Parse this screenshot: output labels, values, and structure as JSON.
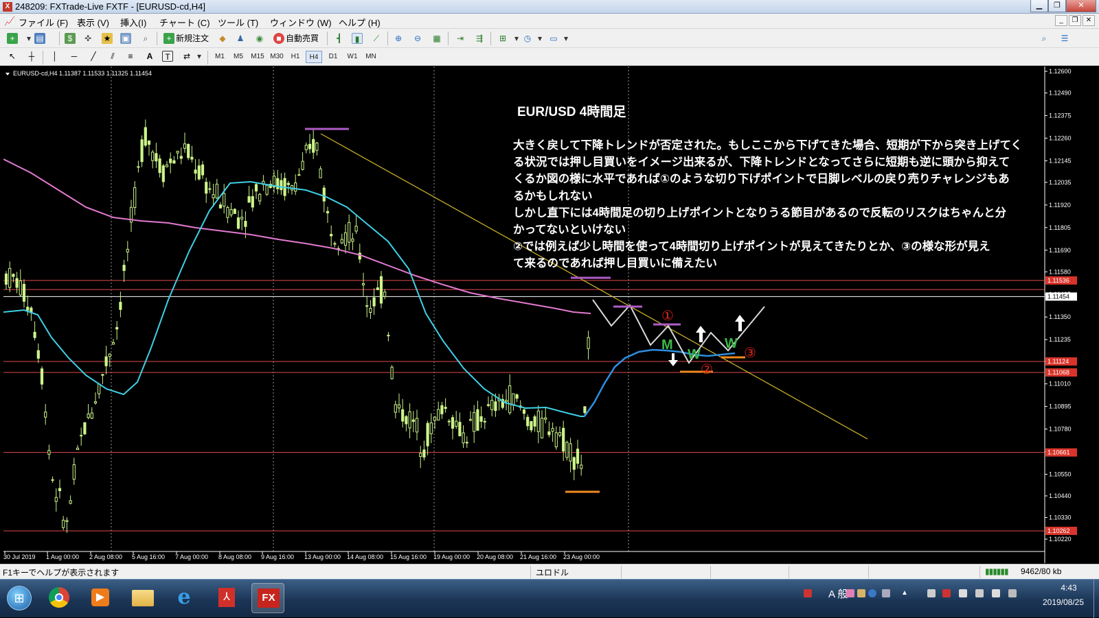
{
  "window": {
    "title": "248209: FXTrade-Live FXTF - [EURUSD-cd,H4]",
    "app_icon": "X"
  },
  "menu": [
    "ファイル (F)",
    "表示 (V)",
    "挿入(I)",
    "チャート (C)",
    "ツール (T)",
    "ウィンドウ (W)",
    "ヘルプ (H)"
  ],
  "toolbar": {
    "new_order": "新規注文",
    "auto_trade": "自動売買"
  },
  "toolbar2": {
    "text_tool": "A",
    "label_tool": "T"
  },
  "timeframes": [
    "M1",
    "M5",
    "M15",
    "M30",
    "H1",
    "H4",
    "D1",
    "W1",
    "MN"
  ],
  "active_timeframe": "H4",
  "chart": {
    "info": "EURUSD-cd,H4  1.11387 1.11533 1.11325 1.11454",
    "background": "#000000",
    "candle_color": "#ccf58a",
    "price_labels": [
      "1.12600",
      "1.12490",
      "1.12375",
      "1.12260",
      "1.12145",
      "1.12035",
      "1.11920",
      "1.11805",
      "1.11690",
      "1.11580",
      "1.11465",
      "1.11350",
      "1.11235",
      "1.11124",
      "1.11010",
      "1.10895",
      "1.10780",
      "1.10665",
      "1.10550",
      "1.10440",
      "1.10330",
      "1.10220"
    ],
    "time_labels": [
      "30 Jul 2019",
      "1 Aug 00:00",
      "2 Aug 08:00",
      "5 Aug 16:00",
      "7 Aug 00:00",
      "8 Aug 08:00",
      "9 Aug 16:00",
      "13 Aug 00:00",
      "14 Aug 08:00",
      "15 Aug 16:00",
      "19 Aug 00:00",
      "20 Aug 08:00",
      "21 Aug 16:00",
      "23 Aug 00:00"
    ],
    "hlines": [
      {
        "label": "1.11536",
        "color": "#e04a4a"
      },
      {
        "label": "1.11454",
        "color": "#ffffff"
      },
      {
        "label": "1.11124",
        "color": "#e04a4a"
      },
      {
        "label": "1.11068",
        "color": "#e04a4a"
      },
      {
        "label": "1.10661",
        "color": "#e04a4a"
      },
      {
        "label": "1.10262",
        "color": "#e04a4a"
      }
    ],
    "annotation_title": "EUR/USD 4時間足",
    "annotation_lines": [
      "大きく戻して下降トレンドが否定された。もしここから下げてきた場合、短期が下から突き上げてく",
      "る状況では押し目買いをイメージ出来るが、下降トレンドとなってさらに短期も逆に頭から抑えて",
      "くるか図の様に水平であれば①のような切り下げポイントで日脚レベルの戻り売りチャレンジもあ",
      "るかもしれない",
      "しかし直下には4時間足の切り上げポイントとなりうる節目があるので反転のリスクはちゃんと分",
      "かってないといけない",
      "②では例えば少し時間を使って4時間切り上げポイントが見えてきたりとか、③の様な形が見え",
      "て来るのであれば押し目買いに備えたい"
    ],
    "markers": [
      "①",
      "②",
      "③"
    ],
    "pattern_letters": [
      "M",
      "W",
      "W"
    ],
    "ma_fast_color": "#3fd0e6",
    "ma_slow_color": "#e37ad0",
    "trendline_color": "#d7b82a"
  },
  "status": {
    "help": "F1キーでヘルプが表示されます",
    "profile": "ユロドル",
    "traffic": "9462/80 kb"
  },
  "taskbar": {
    "ime_text": "A 般",
    "time": "4:43",
    "date": "2019/08/25"
  }
}
